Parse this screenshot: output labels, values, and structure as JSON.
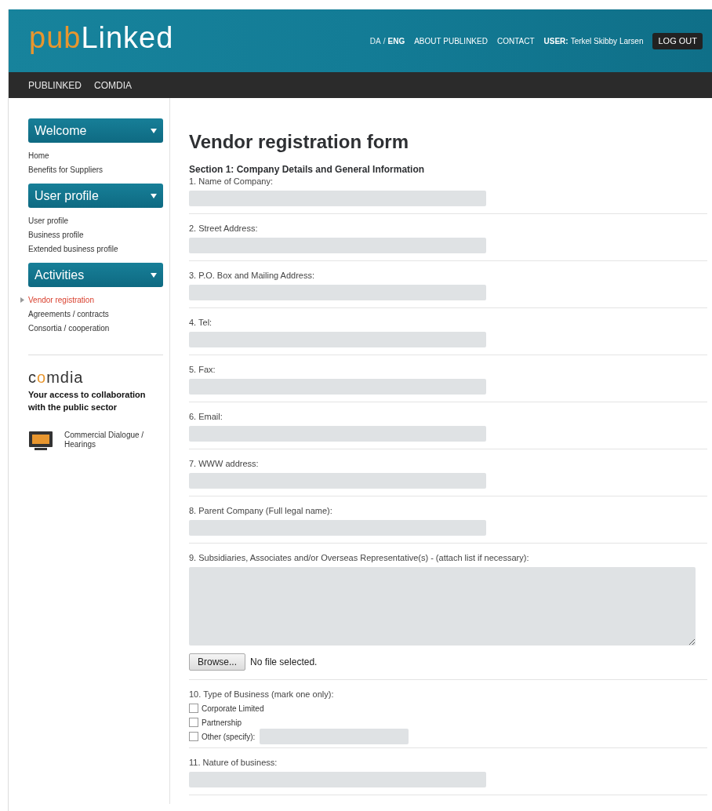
{
  "header": {
    "logo": [
      {
        "text": "pub",
        "color": "#e8962e"
      },
      {
        "text": "Linked",
        "color": "#ffffff"
      }
    ],
    "languages": [
      {
        "label": "DA",
        "selected": false
      },
      {
        "label": "ENG",
        "selected": true
      }
    ],
    "lang_separator": "/",
    "links": [
      "ABOUT PUBLINKED",
      "CONTACT"
    ],
    "user": {
      "label": "USER:",
      "name": "Terkel Skibby Larsen"
    },
    "logout": "LOG OUT"
  },
  "nav": [
    "PUBLINKED",
    "COMDIA"
  ],
  "sidebar": {
    "groups": [
      {
        "title": "Welcome",
        "items": [
          {
            "label": "Home",
            "selected": false
          },
          {
            "label": "Benefits for Suppliers",
            "selected": false
          }
        ]
      },
      {
        "title": "User profile",
        "items": [
          {
            "label": "User profile",
            "selected": false
          },
          {
            "label": "Business profile",
            "selected": false
          },
          {
            "label": "Extended business profile",
            "selected": false
          }
        ]
      },
      {
        "title": "Activities",
        "items": [
          {
            "label": "Vendor registration",
            "selected": true
          },
          {
            "label": "Agreements / contracts",
            "selected": false
          },
          {
            "label": "Consortia / cooperation",
            "selected": false
          }
        ]
      }
    ],
    "comdia": {
      "logo": [
        {
          "text": "c",
          "color": "#333333"
        },
        {
          "text": "o",
          "color": "#e8962e"
        },
        {
          "text": "mdia",
          "color": "#333333"
        }
      ],
      "tagline": "Your access to collaboration with the public sector",
      "link": "Commercial Dialogue / Hearings"
    }
  },
  "form": {
    "title": "Vendor registration form",
    "section": "Section 1: Company Details and General Information",
    "fields": [
      {
        "kind": "text",
        "label": "1. Name of Company:"
      },
      {
        "kind": "text",
        "label": "2. Street Address:"
      },
      {
        "kind": "text",
        "label": "3. P.O. Box and Mailing Address:"
      },
      {
        "kind": "text",
        "label": "4. Tel:"
      },
      {
        "kind": "text",
        "label": "5. Fax:"
      },
      {
        "kind": "text",
        "label": "6. Email:"
      },
      {
        "kind": "text",
        "label": "7. WWW address:"
      },
      {
        "kind": "text",
        "label": "8. Parent Company (Full legal name):"
      },
      {
        "kind": "textarea",
        "label": "9. Subsidiaries, Associates and/or Overseas Representative(s) - (attach list if necessary):",
        "browse": "Browse...",
        "file_status": "No file selected."
      },
      {
        "kind": "checkboxes",
        "label": "10. Type of Business (mark one only):",
        "options": [
          {
            "label": "Corporate Limited",
            "checked": false,
            "specify": false
          },
          {
            "label": "Partnership",
            "checked": false,
            "specify": false
          },
          {
            "label": "Other (specify):",
            "checked": false,
            "specify": true
          }
        ]
      },
      {
        "kind": "text",
        "label": "11. Nature of business:"
      }
    ]
  }
}
